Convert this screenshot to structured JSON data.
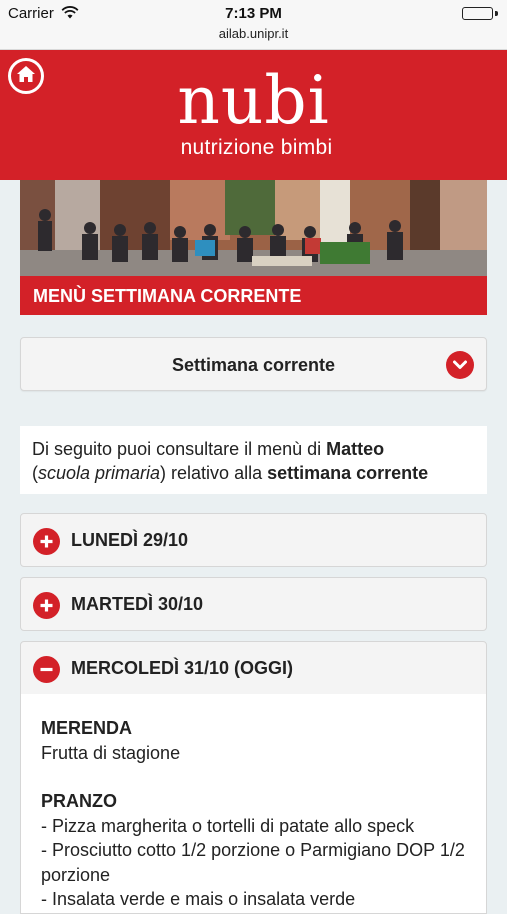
{
  "status_bar": {
    "carrier": "Carrier",
    "time": "7:13 PM",
    "url": "ailab.unipr.it",
    "battery_level": 1.0
  },
  "header": {
    "brand": "nubi",
    "tagline": "nutrizione bimbi",
    "home_icon": "home-icon",
    "color": "#d32128"
  },
  "hero": {
    "banner": "MENÙ SETTIMANA CORRENTE"
  },
  "week_select": {
    "selected": "Settimana corrente",
    "icon": "chevron-down-icon"
  },
  "info": {
    "prefix": "Di seguito puoi consultare il menù di ",
    "child": "Matteo",
    "school_open": "(",
    "school": "scuola primaria",
    "school_close": ") relativo alla ",
    "period": "settimana corrente"
  },
  "days": [
    {
      "label": "LUNEDÌ 29/10",
      "expanded": false,
      "icon": "plus-circle-icon"
    },
    {
      "label": "MARTEDÌ 30/10",
      "expanded": false,
      "icon": "plus-circle-icon"
    },
    {
      "label": "MERCOLEDÌ 31/10 (OGGI)",
      "expanded": true,
      "icon": "minus-circle-icon"
    }
  ],
  "today_menu": {
    "merenda_title": "MERENDA",
    "merenda_items": [
      "Frutta di stagione"
    ],
    "pranzo_title": "PRANZO",
    "pranzo_items": [
      "- Pizza margherita o tortelli di patate allo speck",
      "- Prosciutto cotto 1/2 porzione o Parmigiano DOP 1/2 porzione",
      "- Insalata verde e mais o insalata verde"
    ]
  }
}
